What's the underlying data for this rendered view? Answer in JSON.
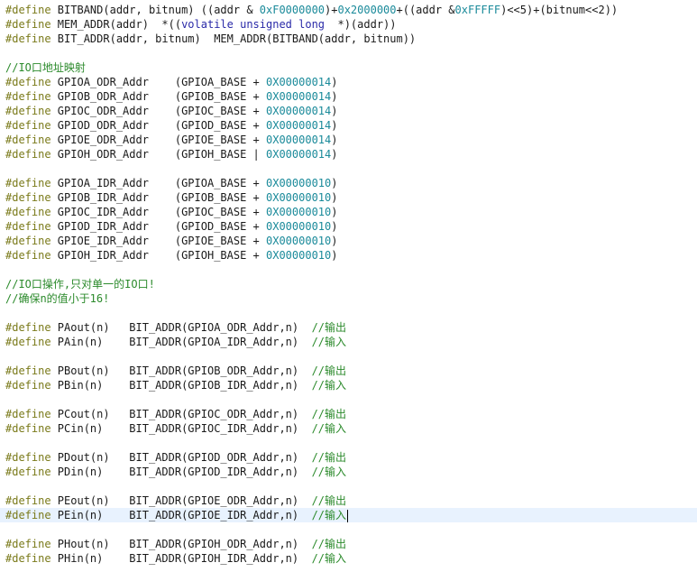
{
  "editor": {
    "current_line": 35,
    "lines": [
      [
        [
          "kw",
          "#define"
        ],
        [
          "t",
          " BITBAND(addr, bitnum) ((addr & "
        ],
        [
          "num",
          "0xF0000000"
        ],
        [
          "t",
          ")+"
        ],
        [
          "num",
          "0x2000000"
        ],
        [
          "t",
          "+((addr &"
        ],
        [
          "num",
          "0xFFFFF"
        ],
        [
          "t",
          ")<<5)+(bitnum<<2))"
        ]
      ],
      [
        [
          "kw",
          "#define"
        ],
        [
          "t",
          " MEM_ADDR(addr)  *(("
        ],
        [
          "typ",
          "volatile unsigned long"
        ],
        [
          "t",
          "  *)(addr))"
        ]
      ],
      [
        [
          "kw",
          "#define"
        ],
        [
          "t",
          " BIT_ADDR(addr, bitnum)  MEM_ADDR(BITBAND(addr, bitnum))"
        ]
      ],
      [],
      [
        [
          "cm",
          "//IO口地址映射"
        ]
      ],
      [
        [
          "kw",
          "#define"
        ],
        [
          "t",
          " GPIOA_ODR_Addr    (GPIOA_BASE + "
        ],
        [
          "num",
          "0X00000014"
        ],
        [
          "t",
          ")"
        ]
      ],
      [
        [
          "kw",
          "#define"
        ],
        [
          "t",
          " GPIOB_ODR_Addr    (GPIOB_BASE + "
        ],
        [
          "num",
          "0X00000014"
        ],
        [
          "t",
          ")"
        ]
      ],
      [
        [
          "kw",
          "#define"
        ],
        [
          "t",
          " GPIOC_ODR_Addr    (GPIOC_BASE + "
        ],
        [
          "num",
          "0X00000014"
        ],
        [
          "t",
          ")"
        ]
      ],
      [
        [
          "kw",
          "#define"
        ],
        [
          "t",
          " GPIOD_ODR_Addr    (GPIOD_BASE + "
        ],
        [
          "num",
          "0X00000014"
        ],
        [
          "t",
          ")"
        ]
      ],
      [
        [
          "kw",
          "#define"
        ],
        [
          "t",
          " GPIOE_ODR_Addr    (GPIOE_BASE + "
        ],
        [
          "num",
          "0X00000014"
        ],
        [
          "t",
          ")"
        ]
      ],
      [
        [
          "kw",
          "#define"
        ],
        [
          "t",
          " GPIOH_ODR_Addr    (GPIOH_BASE | "
        ],
        [
          "num",
          "0X00000014"
        ],
        [
          "t",
          ")"
        ]
      ],
      [],
      [
        [
          "kw",
          "#define"
        ],
        [
          "t",
          " GPIOA_IDR_Addr    (GPIOA_BASE + "
        ],
        [
          "num",
          "0X00000010"
        ],
        [
          "t",
          ")"
        ]
      ],
      [
        [
          "kw",
          "#define"
        ],
        [
          "t",
          " GPIOB_IDR_Addr    (GPIOB_BASE + "
        ],
        [
          "num",
          "0X00000010"
        ],
        [
          "t",
          ")"
        ]
      ],
      [
        [
          "kw",
          "#define"
        ],
        [
          "t",
          " GPIOC_IDR_Addr    (GPIOC_BASE + "
        ],
        [
          "num",
          "0X00000010"
        ],
        [
          "t",
          ")"
        ]
      ],
      [
        [
          "kw",
          "#define"
        ],
        [
          "t",
          " GPIOD_IDR_Addr    (GPIOD_BASE + "
        ],
        [
          "num",
          "0X00000010"
        ],
        [
          "t",
          ")"
        ]
      ],
      [
        [
          "kw",
          "#define"
        ],
        [
          "t",
          " GPIOE_IDR_Addr    (GPIOE_BASE + "
        ],
        [
          "num",
          "0X00000010"
        ],
        [
          "t",
          ")"
        ]
      ],
      [
        [
          "kw",
          "#define"
        ],
        [
          "t",
          " GPIOH_IDR_Addr    (GPIOH_BASE + "
        ],
        [
          "num",
          "0X00000010"
        ],
        [
          "t",
          ")"
        ]
      ],
      [],
      [
        [
          "cm",
          "//IO口操作,只对单一的IO口!"
        ]
      ],
      [
        [
          "cm",
          "//确保n的值小于16!"
        ]
      ],
      [],
      [
        [
          "kw",
          "#define"
        ],
        [
          "t",
          " PAout(n)   BIT_ADDR(GPIOA_ODR_Addr,n)  "
        ],
        [
          "cm",
          "//输出"
        ]
      ],
      [
        [
          "kw",
          "#define"
        ],
        [
          "t",
          " PAin(n)    BIT_ADDR(GPIOA_IDR_Addr,n)  "
        ],
        [
          "cm",
          "//输入"
        ]
      ],
      [],
      [
        [
          "kw",
          "#define"
        ],
        [
          "t",
          " PBout(n)   BIT_ADDR(GPIOB_ODR_Addr,n)  "
        ],
        [
          "cm",
          "//输出"
        ]
      ],
      [
        [
          "kw",
          "#define"
        ],
        [
          "t",
          " PBin(n)    BIT_ADDR(GPIOB_IDR_Addr,n)  "
        ],
        [
          "cm",
          "//输入"
        ]
      ],
      [],
      [
        [
          "kw",
          "#define"
        ],
        [
          "t",
          " PCout(n)   BIT_ADDR(GPIOC_ODR_Addr,n)  "
        ],
        [
          "cm",
          "//输出"
        ]
      ],
      [
        [
          "kw",
          "#define"
        ],
        [
          "t",
          " PCin(n)    BIT_ADDR(GPIOC_IDR_Addr,n)  "
        ],
        [
          "cm",
          "//输入"
        ]
      ],
      [],
      [
        [
          "kw",
          "#define"
        ],
        [
          "t",
          " PDout(n)   BIT_ADDR(GPIOD_ODR_Addr,n)  "
        ],
        [
          "cm",
          "//输出"
        ]
      ],
      [
        [
          "kw",
          "#define"
        ],
        [
          "t",
          " PDin(n)    BIT_ADDR(GPIOD_IDR_Addr,n)  "
        ],
        [
          "cm",
          "//输入"
        ]
      ],
      [],
      [
        [
          "kw",
          "#define"
        ],
        [
          "t",
          " PEout(n)   BIT_ADDR(GPIOE_ODR_Addr,n)  "
        ],
        [
          "cm",
          "//输出"
        ]
      ],
      [
        [
          "kw",
          "#define"
        ],
        [
          "t",
          " PEin(n)    BIT_ADDR(GPIOE_IDR_Addr,n)  "
        ],
        [
          "cm",
          "//输入"
        ]
      ],
      [],
      [
        [
          "kw",
          "#define"
        ],
        [
          "t",
          " PHout(n)   BIT_ADDR(GPIOH_ODR_Addr,n)  "
        ],
        [
          "cm",
          "//输出"
        ]
      ],
      [
        [
          "kw",
          "#define"
        ],
        [
          "t",
          " PHin(n)    BIT_ADDR(GPIOH_IDR_Addr,n)  "
        ],
        [
          "cm",
          "//输入"
        ]
      ]
    ]
  }
}
